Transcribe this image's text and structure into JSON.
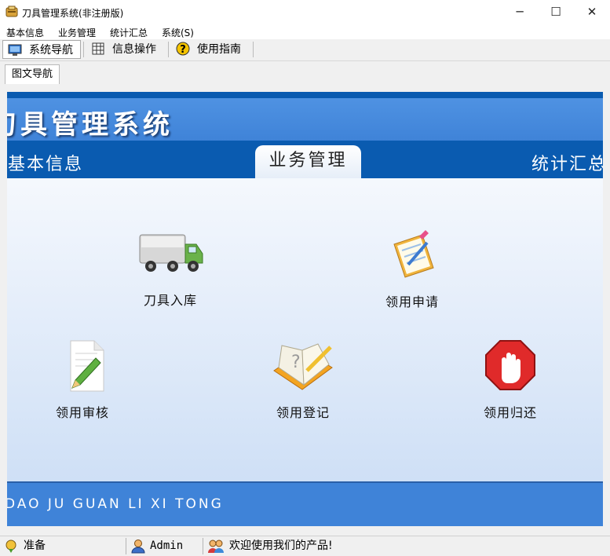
{
  "window": {
    "title": "刀具管理系统(非注册版)",
    "minimize": "─",
    "maximize": "☐",
    "close": "✕"
  },
  "menu": [
    "基本信息",
    "业务管理",
    "统计汇总",
    "系统(S)"
  ],
  "toolbar": [
    {
      "label": "系统导航",
      "icon": "monitor-icon"
    },
    {
      "label": "信息操作",
      "icon": "grid-icon"
    },
    {
      "label": "使用指南",
      "icon": "help-icon"
    }
  ],
  "doc_tab": "图文导航",
  "banner": {
    "title": "刀具管理系统",
    "nav": {
      "left": "基本信息",
      "active": "业务管理",
      "right": "统计汇总"
    },
    "footer": "DAO JU GUAN LI XI TONG"
  },
  "tiles": [
    {
      "label": "刀具入库",
      "icon": "truck-icon"
    },
    {
      "label": "领用申请",
      "icon": "clipboard-icon"
    },
    {
      "label": "领用审核",
      "icon": "document-pencil-icon"
    },
    {
      "label": "领用登记",
      "icon": "notebook-icon"
    },
    {
      "label": "领用归还",
      "icon": "stop-hand-icon"
    }
  ],
  "status": {
    "ready": "准备",
    "user": "Admin",
    "welcome": "欢迎使用我们的产品!"
  },
  "colors": {
    "band_dark": "#0a5bb0",
    "band_light": "#3f83d8"
  }
}
